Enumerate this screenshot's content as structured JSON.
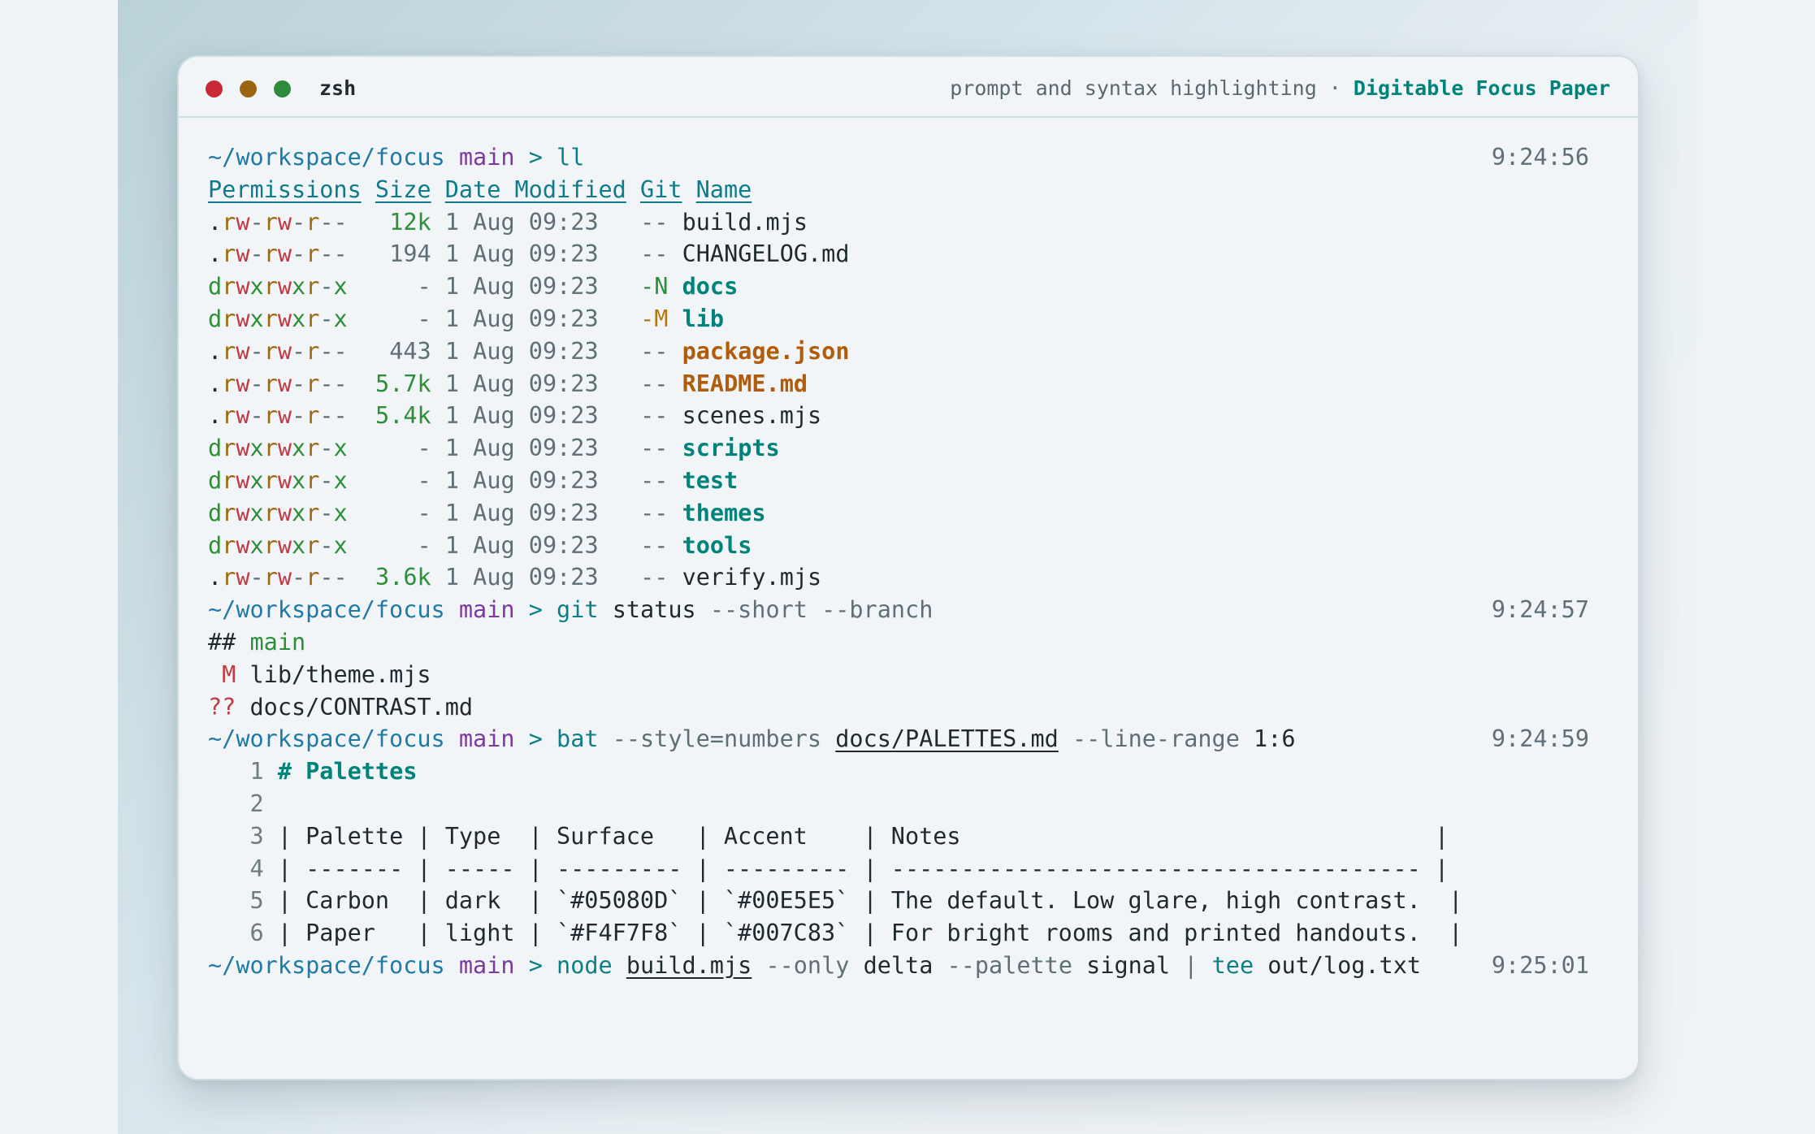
{
  "window": {
    "title": "zsh",
    "subtitle": "prompt and syntax highlighting · ",
    "brand": "Digitable Focus Paper"
  },
  "prompts": [
    {
      "path": "~/workspace/focus",
      "branch": "main",
      "arrow": ">",
      "time": "9:24:56",
      "cmd": "ll",
      "args": []
    },
    {
      "path": "~/workspace/focus",
      "branch": "main",
      "arrow": ">",
      "time": "9:24:57",
      "cmd": "git",
      "args": [
        "status",
        "--short",
        "--branch"
      ]
    },
    {
      "path": "~/workspace/focus",
      "branch": "main",
      "arrow": ">",
      "time": "9:24:59",
      "cmd": "bat",
      "args": [
        "--style=numbers",
        "docs/PALETTES.md",
        "--line-range",
        "1:6"
      ]
    },
    {
      "path": "~/workspace/focus",
      "branch": "main",
      "arrow": ">",
      "time": "9:25:01",
      "cmd": "node",
      "args": [
        "build.mjs",
        "--only",
        "delta",
        "--palette",
        "signal",
        "|",
        "tee",
        "out/log.txt"
      ]
    }
  ],
  "listing": {
    "headers": [
      "Permissions",
      "Size",
      "Date Modified",
      "Git",
      "Name"
    ],
    "rows": [
      {
        "perm": ".rw-rw-r--",
        "size": "12k",
        "date": "1 Aug 09:23",
        "git": "--",
        "name": "build.mjs",
        "kind": "file"
      },
      {
        "perm": ".rw-rw-r--",
        "size": "194",
        "date": "1 Aug 09:23",
        "git": "--",
        "name": "CHANGELOG.md",
        "kind": "file"
      },
      {
        "perm": "drwxrwxr-x",
        "size": "-",
        "date": "1 Aug 09:23",
        "git": "-N",
        "name": "docs",
        "kind": "dir"
      },
      {
        "perm": "drwxrwxr-x",
        "size": "-",
        "date": "1 Aug 09:23",
        "git": "-M",
        "name": "lib",
        "kind": "dir"
      },
      {
        "perm": ".rw-rw-r--",
        "size": "443",
        "date": "1 Aug 09:23",
        "git": "--",
        "name": "package.json",
        "kind": "hi"
      },
      {
        "perm": ".rw-rw-r--",
        "size": "5.7k",
        "date": "1 Aug 09:23",
        "git": "--",
        "name": "README.md",
        "kind": "hi"
      },
      {
        "perm": ".rw-rw-r--",
        "size": "5.4k",
        "date": "1 Aug 09:23",
        "git": "--",
        "name": "scenes.mjs",
        "kind": "file"
      },
      {
        "perm": "drwxrwxr-x",
        "size": "-",
        "date": "1 Aug 09:23",
        "git": "--",
        "name": "scripts",
        "kind": "dir"
      },
      {
        "perm": "drwxrwxr-x",
        "size": "-",
        "date": "1 Aug 09:23",
        "git": "--",
        "name": "test",
        "kind": "dir"
      },
      {
        "perm": "drwxrwxr-x",
        "size": "-",
        "date": "1 Aug 09:23",
        "git": "--",
        "name": "themes",
        "kind": "dir"
      },
      {
        "perm": "drwxrwxr-x",
        "size": "-",
        "date": "1 Aug 09:23",
        "git": "--",
        "name": "tools",
        "kind": "dir"
      },
      {
        "perm": ".rw-rw-r--",
        "size": "3.6k",
        "date": "1 Aug 09:23",
        "git": "--",
        "name": "verify.mjs",
        "kind": "file"
      }
    ]
  },
  "git_status": {
    "branch_marker": "##",
    "branch": "main",
    "entries": [
      {
        "code": " M",
        "path": "lib/theme.mjs"
      },
      {
        "code": "??",
        "path": "docs/CONTRAST.md"
      }
    ]
  },
  "bat": {
    "lines": [
      {
        "n": "1",
        "text": "# Palettes",
        "style": "heading"
      },
      {
        "n": "2",
        "text": "",
        "style": "plain"
      },
      {
        "n": "3",
        "text": "| Palette | Type  | Surface   | Accent    | Notes                                  |",
        "style": "plain"
      },
      {
        "n": "4",
        "text": "| ------- | ----- | --------- | --------- | -------------------------------------- |",
        "style": "plain"
      },
      {
        "n": "5",
        "text": "| Carbon  | dark  | `#05080D` | `#00E5E5` | The default. Low glare, high contrast.  |",
        "style": "plain"
      },
      {
        "n": "6",
        "text": "| Paper   | light | `#F4F7F8` | `#007C83` | For bright rooms and printed handouts.  |",
        "style": "plain"
      }
    ]
  },
  "colors": {
    "path": "#1f7aa5",
    "branch": "#7c3aa0",
    "command": "#0c7f86",
    "directory": "#00837a",
    "highlight_file": "#b05c0a",
    "write": "#c23a45",
    "new": "#2f8e3a",
    "modified": "#b07a10"
  }
}
